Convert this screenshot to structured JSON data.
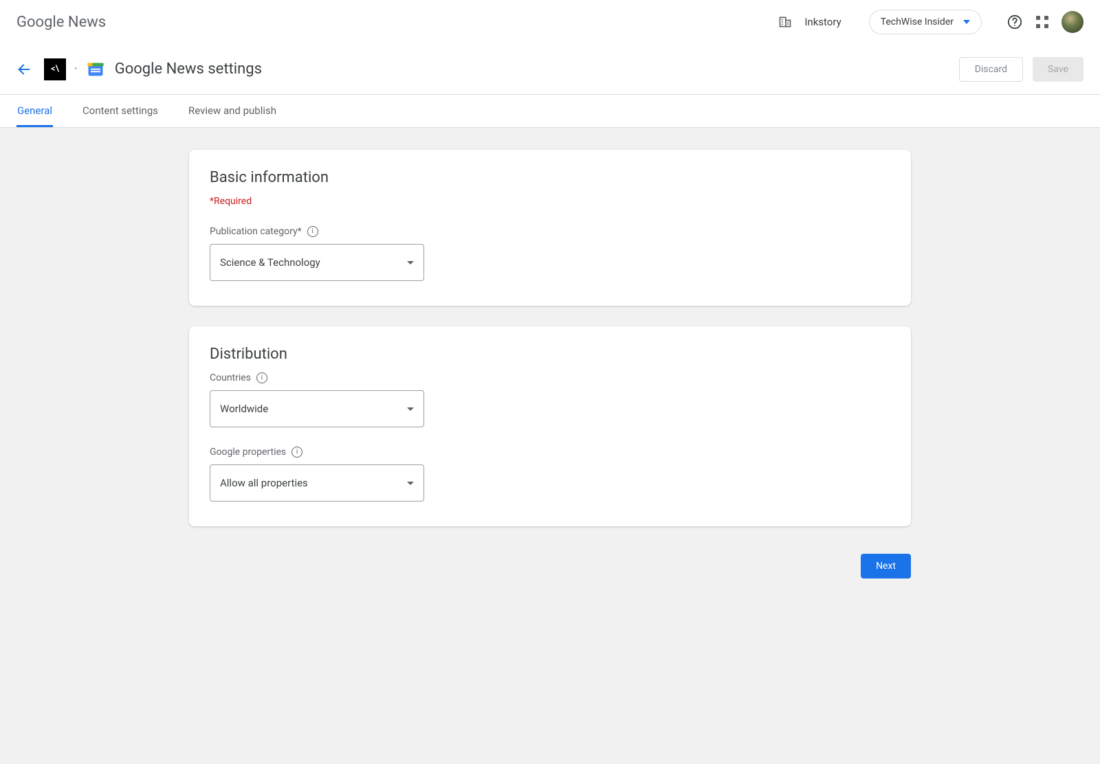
{
  "topbar": {
    "brand": "Google News",
    "org_name": "Inkstory",
    "publication_name": "TechWise Insider"
  },
  "subheader": {
    "pub_badge": "<\\",
    "page_title": "Google News settings",
    "discard_label": "Discard",
    "save_label": "Save"
  },
  "tabs": [
    {
      "label": "General",
      "active": true
    },
    {
      "label": "Content settings",
      "active": false
    },
    {
      "label": "Review and publish",
      "active": false
    }
  ],
  "cards": {
    "basic_info": {
      "title": "Basic information",
      "required_note": "*Required",
      "publication_category": {
        "label": "Publication category*",
        "value": "Science & Technology"
      }
    },
    "distribution": {
      "title": "Distribution",
      "countries": {
        "label": "Countries",
        "value": "Worldwide"
      },
      "google_properties": {
        "label": "Google properties",
        "value": "Allow all properties"
      }
    }
  },
  "actions": {
    "next_label": "Next"
  }
}
